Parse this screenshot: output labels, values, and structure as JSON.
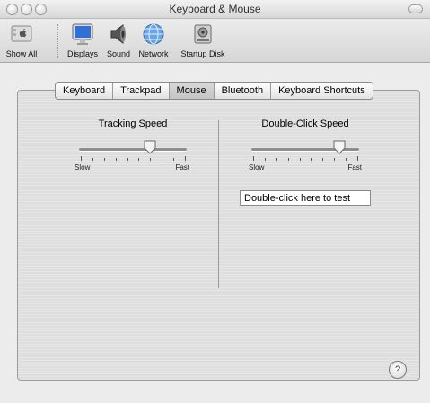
{
  "window": {
    "title": "Keyboard & Mouse"
  },
  "toolbar": {
    "items": [
      {
        "label": "Show All",
        "icon": "apple-icon"
      },
      {
        "label": "Displays",
        "icon": "display-icon"
      },
      {
        "label": "Sound",
        "icon": "speaker-icon"
      },
      {
        "label": "Network",
        "icon": "globe-icon"
      },
      {
        "label": "Startup Disk",
        "icon": "disk-icon"
      }
    ]
  },
  "tabs": [
    {
      "label": "Keyboard",
      "selected": false
    },
    {
      "label": "Trackpad",
      "selected": false
    },
    {
      "label": "Mouse",
      "selected": true
    },
    {
      "label": "Bluetooth",
      "selected": false
    },
    {
      "label": "Keyboard Shortcuts",
      "selected": false
    }
  ],
  "tracking": {
    "title": "Tracking Speed",
    "min_label": "Slow",
    "max_label": "Fast",
    "value": 0.66
  },
  "double_click": {
    "title": "Double-Click Speed",
    "min_label": "Slow",
    "max_label": "Fast",
    "value": 0.83
  },
  "test_field": {
    "value": "Double-click here to test"
  },
  "help": {
    "label": "?"
  }
}
